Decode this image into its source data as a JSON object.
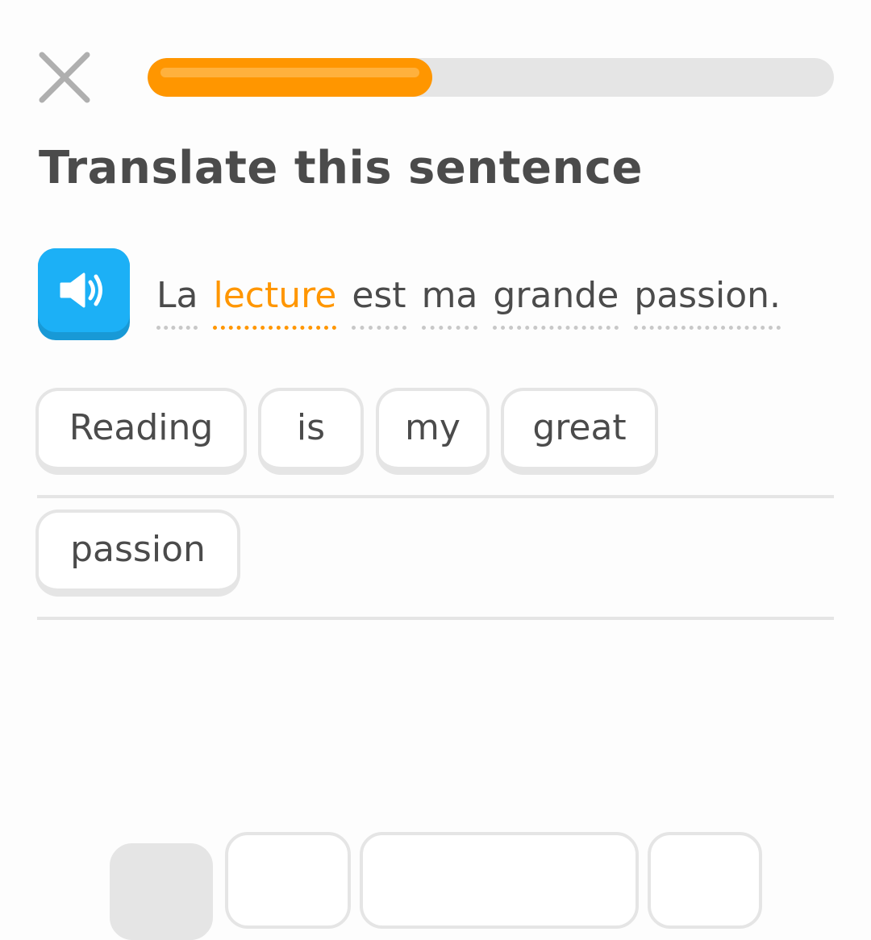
{
  "header": {
    "close_icon": "close-icon",
    "progress": 0.415,
    "progress_color": "#ff9600"
  },
  "prompt": {
    "title": "Translate this sentence",
    "speaker_icon": "speaker-icon",
    "words": [
      "La",
      "lecture",
      "est",
      "ma",
      "grande",
      "passion."
    ],
    "highlighted_word_index": 1,
    "highlight_color": "#ff9600"
  },
  "answer": {
    "tiles": [
      "Reading",
      "is",
      "my",
      "great",
      "passion"
    ]
  },
  "word_bank": {
    "tiles_partially_visible": 4
  }
}
